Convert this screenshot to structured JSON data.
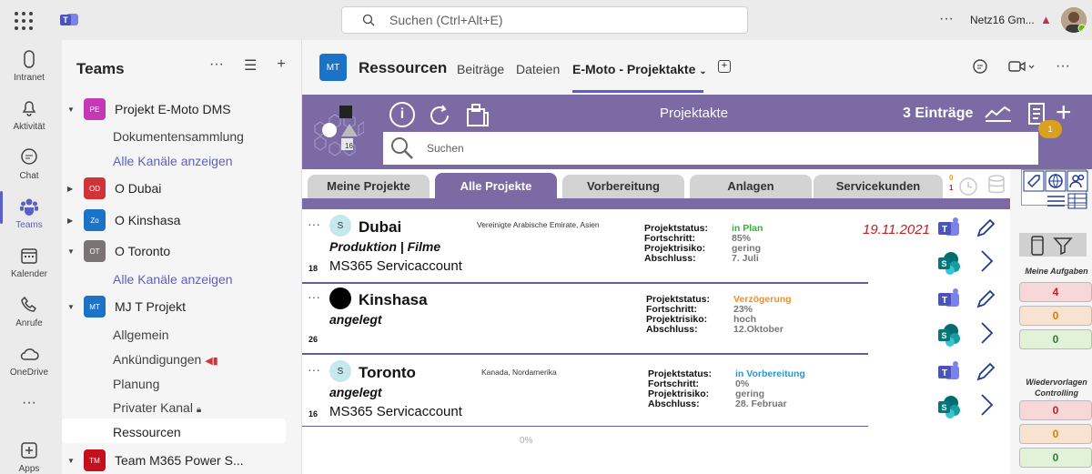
{
  "topbar": {
    "search_placeholder": "Suchen (Ctrl+Alt+E)",
    "more": "···",
    "tenant": "Netz16 Gm...",
    "warning": "▲"
  },
  "rail": {
    "items": [
      {
        "label": "Intranet",
        "icon": "intranet-icon"
      },
      {
        "label": "Aktivität",
        "icon": "bell-icon"
      },
      {
        "label": "Chat",
        "icon": "chat-icon"
      },
      {
        "label": "Teams",
        "icon": "teams-icon"
      },
      {
        "label": "Kalender",
        "icon": "calendar-icon"
      },
      {
        "label": "Anrufe",
        "icon": "phone-icon"
      },
      {
        "label": "OneDrive",
        "icon": "cloud-icon"
      },
      {
        "label": "···",
        "icon": "more-icon"
      },
      {
        "label": "Apps",
        "icon": "apps-icon"
      }
    ]
  },
  "teams_panel": {
    "title": "Teams",
    "teams": [
      {
        "abbr": "PE",
        "name": "Projekt E-Moto DMS",
        "color": "#c239b3"
      },
      {
        "abbr": "OD",
        "name": "O Dubai",
        "color": "#d13438"
      },
      {
        "abbr": "Zo",
        "name": "O Kinshasa",
        "color": "#1a73c7"
      },
      {
        "abbr": "OT",
        "name": "O Toronto",
        "color": "#7a7574"
      },
      {
        "abbr": "MT",
        "name": "MJ T Projekt",
        "color": "#1a73c7"
      },
      {
        "abbr": "TM",
        "name": "Team M365 Power S...",
        "color": "#c50f1f"
      }
    ],
    "channels": {
      "pe_docs": "Dokumentensammlung",
      "pe_all": "Alle Kanäle anzeigen",
      "ot_all": "Alle Kanäle anzeigen",
      "mt_general": "Allgemein",
      "mt_news": "Ankündigungen",
      "mt_plan": "Planung",
      "mt_private": "Privater Kanal",
      "mt_resources": "Ressourcen"
    }
  },
  "channel_header": {
    "avatar": "MT",
    "name": "Ressourcen",
    "tabs": [
      "Beiträge",
      "Dateien",
      "E-Moto - Projektakte"
    ],
    "add": "+"
  },
  "app": {
    "title": "Projektakte",
    "entries": "3 Einträge",
    "badge": "1",
    "search_placeholder": "Suchen",
    "tabs": [
      "Meine Projekte",
      "Alle Projekte",
      "Vorbereitung",
      "Anlagen",
      "Servicekunden"
    ],
    "clock_counts": [
      "0",
      "1"
    ],
    "progress_label": "0%",
    "labels": {
      "status": "Projektstatus:",
      "progress": "Fortschritt:",
      "risk": "Projektrisiko:",
      "completion": "Abschluss:"
    },
    "projects": [
      {
        "avatar": "S",
        "name": "Dubai",
        "location": "Vereinigte Arabische Emirate, Asien",
        "subtitle": "Produktion | Filme",
        "number": "18",
        "account": "MS365 Servicaccount",
        "status": "in Plan",
        "status_color": "#2eb82e",
        "progress": "85%",
        "risk": "gering",
        "completion": "7. Juli",
        "date": "19.11.2021"
      },
      {
        "avatar": "",
        "name": "Kinshasa",
        "location": "",
        "subtitle": "angelegt",
        "number": "26",
        "account": "",
        "status": "Verzögerung",
        "status_color": "#ff8c1a",
        "progress": "23%",
        "risk": "hoch",
        "completion": "12.Oktober",
        "date": ""
      },
      {
        "avatar": "S",
        "name": "Toronto",
        "location": "Kanada, Nordamerika",
        "subtitle": "angelegt",
        "number": "16",
        "account": "MS365 Servicaccount",
        "status": "in Vorbereitung",
        "status_color": "#1a9ee0",
        "progress": "0%",
        "risk": "gering",
        "completion": "28. Februar",
        "date": ""
      }
    ],
    "right_panel": {
      "my_tasks": "Meine Aufgaben",
      "my_tasks_values": [
        "4",
        "0",
        "0"
      ],
      "resubmission": "Wiedervorlagen Controlling",
      "resubmission_values": [
        "0",
        "0",
        "0"
      ]
    }
  }
}
